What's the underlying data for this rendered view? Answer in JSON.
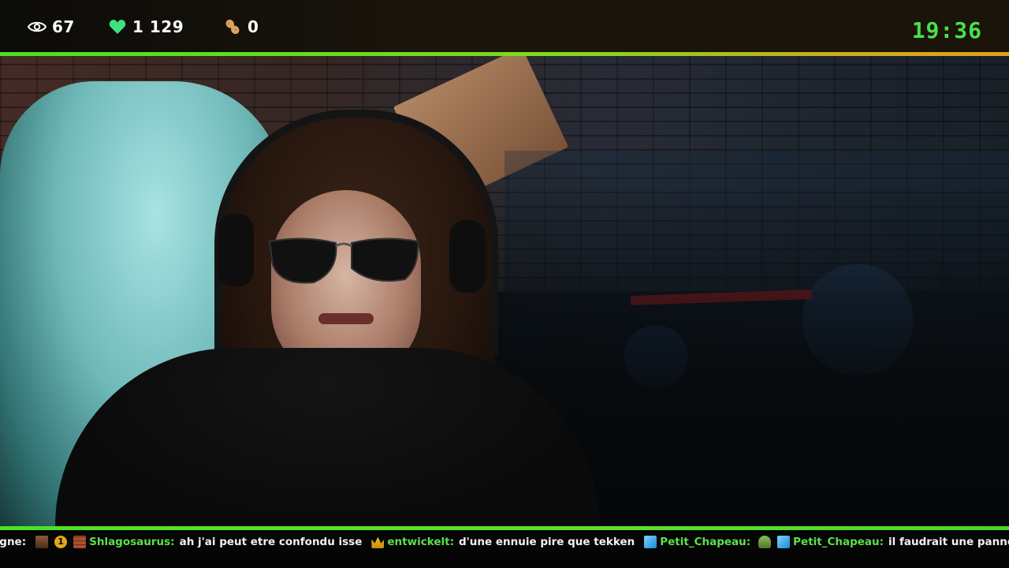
{
  "stream_header": {
    "viewers": "67",
    "likes": "1 129",
    "peanuts": "0",
    "clock": "19:36",
    "accent_color": "#4be04b"
  },
  "chat_ticker": [
    {
      "user": "",
      "message": "ogne:",
      "emotes": [
        "man-face-icon",
        "rank-1-icon",
        "brick-icon"
      ]
    },
    {
      "user": "Shlagosaurus:",
      "message": "ah j'ai peut etre confondu isse",
      "emotes": [
        "crown-icon"
      ]
    },
    {
      "user": "entwickelt:",
      "message": "d'une ennuie pire que tekken",
      "emotes": [
        "cube-icon"
      ]
    },
    {
      "user": "Petit_Chapeau:",
      "message": "",
      "emotes": [
        "turtle-icon",
        "cube-icon"
      ]
    },
    {
      "user": "Petit_Chapeau:",
      "message": "il faudrait une panne des serveurs discord",
      "emotes": []
    }
  ]
}
